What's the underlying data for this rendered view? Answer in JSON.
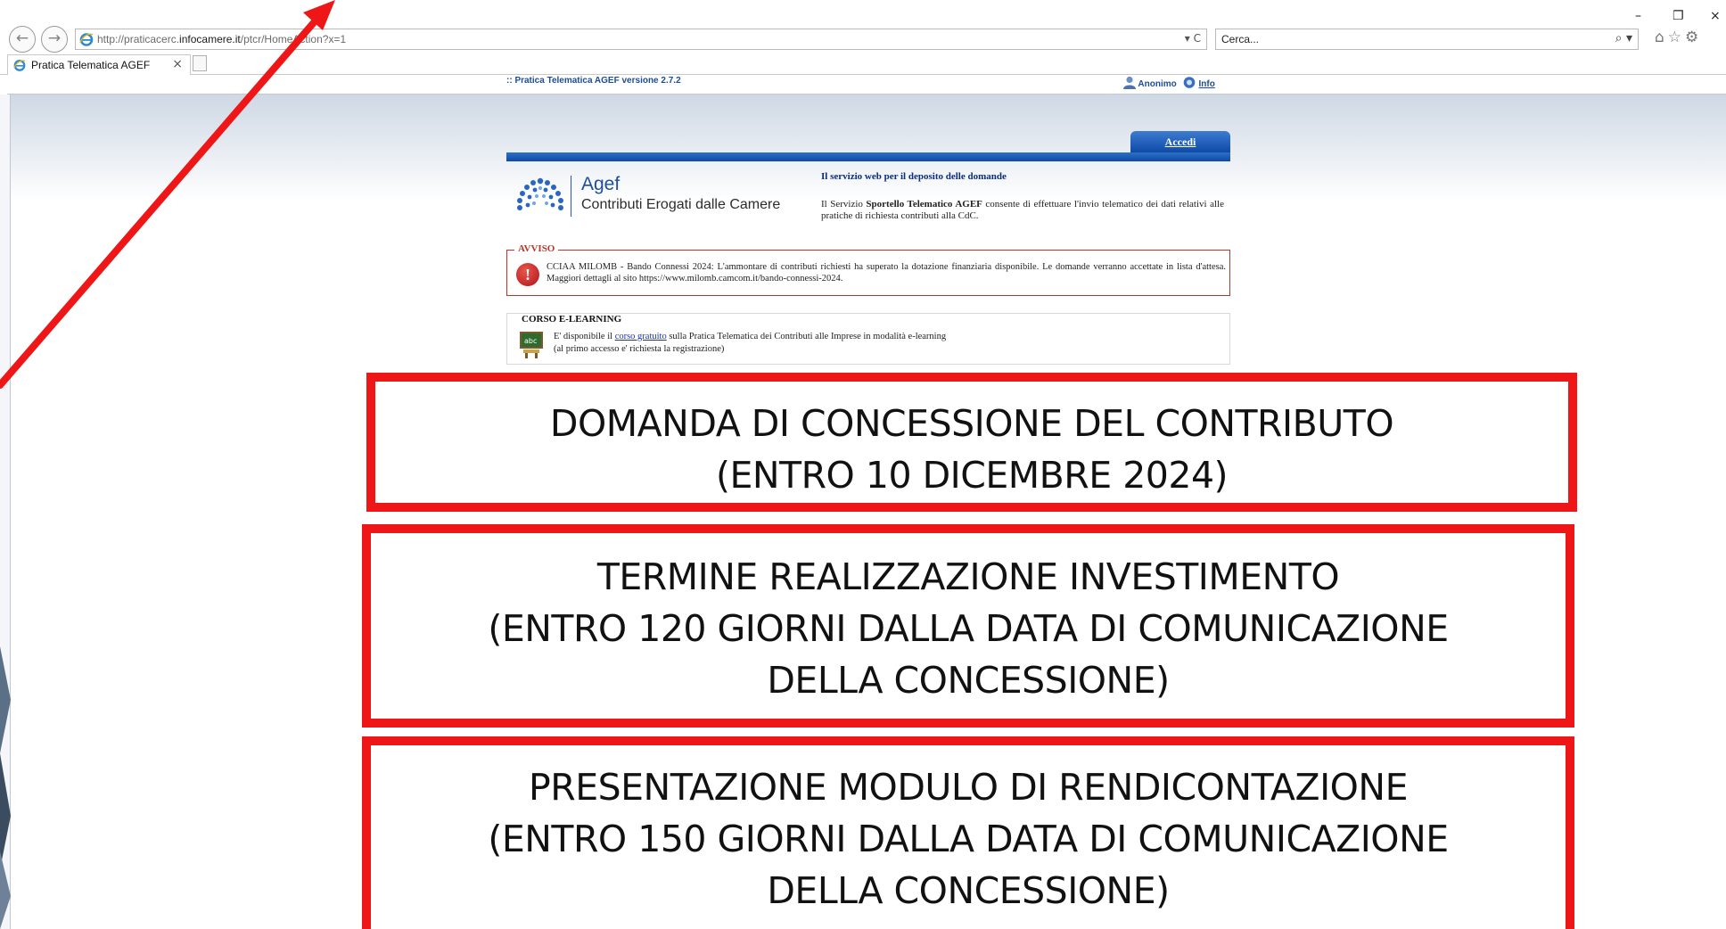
{
  "browser": {
    "url_prefix": "http://praticacerc.",
    "url_domain": "infocamere.it",
    "url_suffix": "/ptcr/HomeAction?x=1",
    "address_controls": "▾ C",
    "search_placeholder": "Cerca...",
    "search_icon": "⌕ ▾",
    "minimize": "–",
    "restore": "❐",
    "close": "×",
    "tool_icons": "⌂☆⚙",
    "tab_title": "Pratica Telematica AGEF",
    "tab_close": "×",
    "back": "←",
    "forward": "→"
  },
  "header": {
    "version": ":: Pratica Telematica AGEF versione 2.7.2",
    "user": "Anonimo",
    "info": "Info"
  },
  "access": {
    "label": "Accedi"
  },
  "logo": {
    "name": "Agef",
    "subtitle": "Contributi Erogati dalle Camere"
  },
  "service": {
    "title": "Il servizio web per il deposito delle domande",
    "desc_pre": "Il Servizio ",
    "desc_bold": "Sportello Telematico AGEF",
    "desc_post": " consente di effettuare l'invio telematico dei dati relativi alle pratiche di richiesta contributi alla CdC."
  },
  "avviso": {
    "legend": "AVVISO",
    "icon": "!",
    "text": "CCIAA MILOMB - Bando Connessi 2024: L'ammontare di contributi richiesti ha superato la dotazione finanziaria disponibile. Le domande verranno accettate in lista d'attesa. Maggiori dettagli al sito https://www.milomb.camcom.it/bando-connessi-2024."
  },
  "corso": {
    "title": "CORSO E-LEARNING",
    "text_pre": "E' disponibile il ",
    "link": "corso gratuito",
    "text_post": " sulla Pratica Telematica dei Contributi alle Imprese in modalità e-learning",
    "note": "(al primo accesso e' richiesta la registrazione)"
  },
  "boxes": [
    {
      "lines": [
        "DOMANDA  DI CONCESSIONE DEL CONTRIBUTO",
        "(ENTRO 10 DICEMBRE 2024)"
      ]
    },
    {
      "lines": [
        "TERMINE REALIZZAZIONE INVESTIMENTO",
        "(ENTRO 120 GIORNI DALLA DATA DI COMUNICAZIONE",
        "DELLA CONCESSIONE)"
      ]
    },
    {
      "lines": [
        "PRESENTAZIONE MODULO DI RENDICONTAZIONE",
        "(ENTRO 150 GIORNI DALLA DATA DI COMUNICAZIONE",
        "DELLA CONCESSIONE)"
      ]
    }
  ],
  "colors": {
    "annotation_red": "#ee1616",
    "agef_blue": "#1e4f9b",
    "avviso_red": "#b5392b"
  }
}
